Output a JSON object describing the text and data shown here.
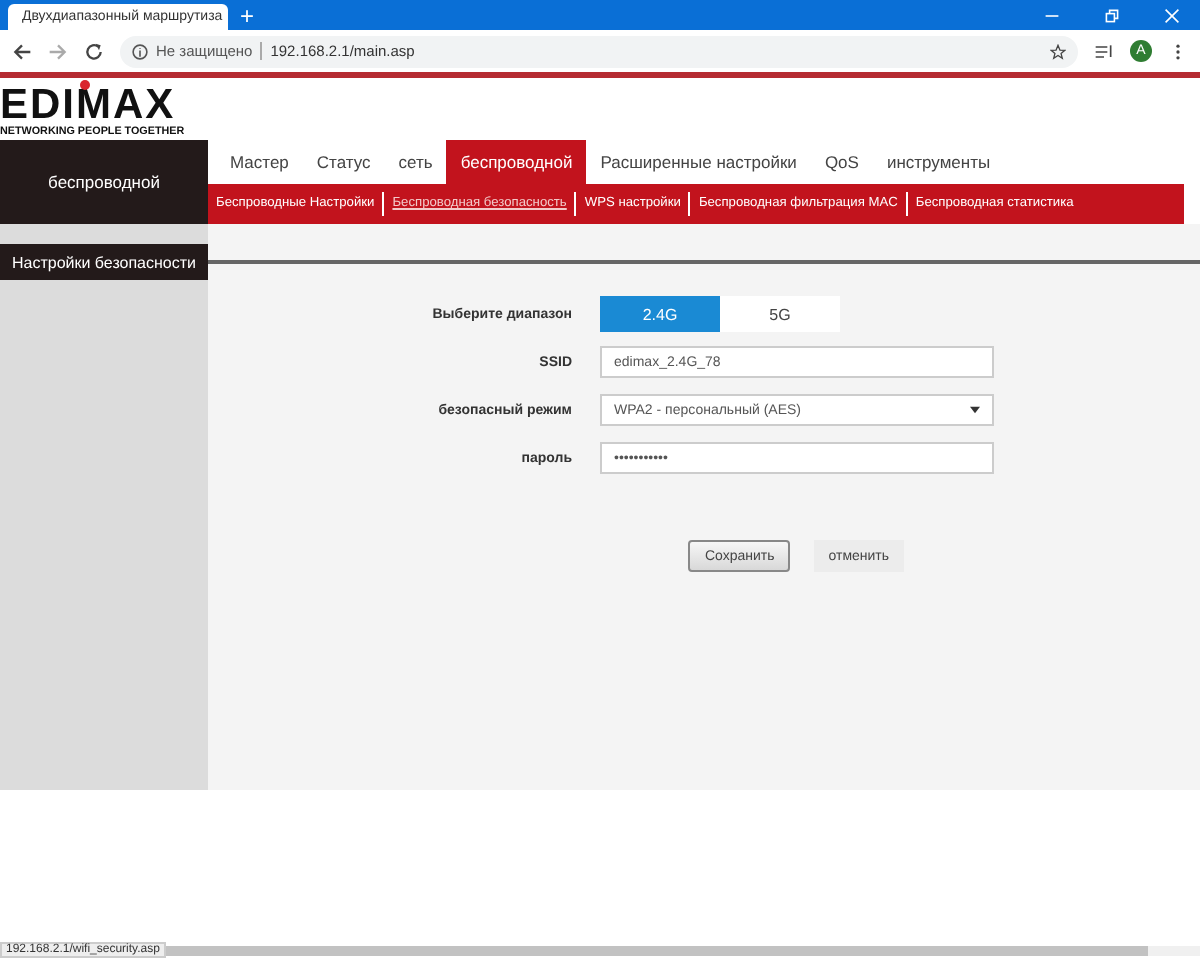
{
  "browser": {
    "tab_title": "Двухдиапазонный маршрутиза",
    "new_tab": "+",
    "security": "Не защищено",
    "address": "192.168.2.1/main.asp",
    "avatar": "A"
  },
  "logo": {
    "name": "EDIMAX",
    "tagline": "NETWORKING PEOPLE TOGETHER"
  },
  "section": "беспроводной",
  "tabs": [
    {
      "label": "Мастер",
      "selected": false
    },
    {
      "label": "Статус",
      "selected": false
    },
    {
      "label": "сеть",
      "selected": false
    },
    {
      "label": "беспроводной",
      "selected": true
    },
    {
      "label": "Расширенные настройки",
      "selected": false
    },
    {
      "label": "QoS",
      "selected": false
    },
    {
      "label": "инструменты",
      "selected": false
    }
  ],
  "subtabs": [
    {
      "label": "Беспроводные Настройки",
      "selected": false
    },
    {
      "label": "Беспроводная безопасность",
      "selected": true
    },
    {
      "label": "WPS настройки",
      "selected": false
    },
    {
      "label": "Беспроводная фильтрация MAC",
      "selected": false
    },
    {
      "label": "Беспроводная статистика",
      "selected": false
    }
  ],
  "sidebar": {
    "items": [
      {
        "label": "Настройки безопасности",
        "selected": true
      }
    ]
  },
  "form": {
    "band_label": "Выберите диапазон",
    "bands": [
      {
        "label": "2.4G",
        "selected": true
      },
      {
        "label": "5G",
        "selected": false
      }
    ],
    "ssid_label": "SSID",
    "ssid": "edimax_2.4G_78",
    "mode_label": "безопасный режим",
    "mode": "WPA2 - персональный (AES)",
    "password_label": "пароль",
    "password": "•••••••••••",
    "buttons": [
      {
        "label": "Сохранить",
        "kind": "primary"
      },
      {
        "label": "отменить",
        "kind": "flat"
      }
    ]
  },
  "status_url": "192.168.2.1/wifi_security.asp"
}
